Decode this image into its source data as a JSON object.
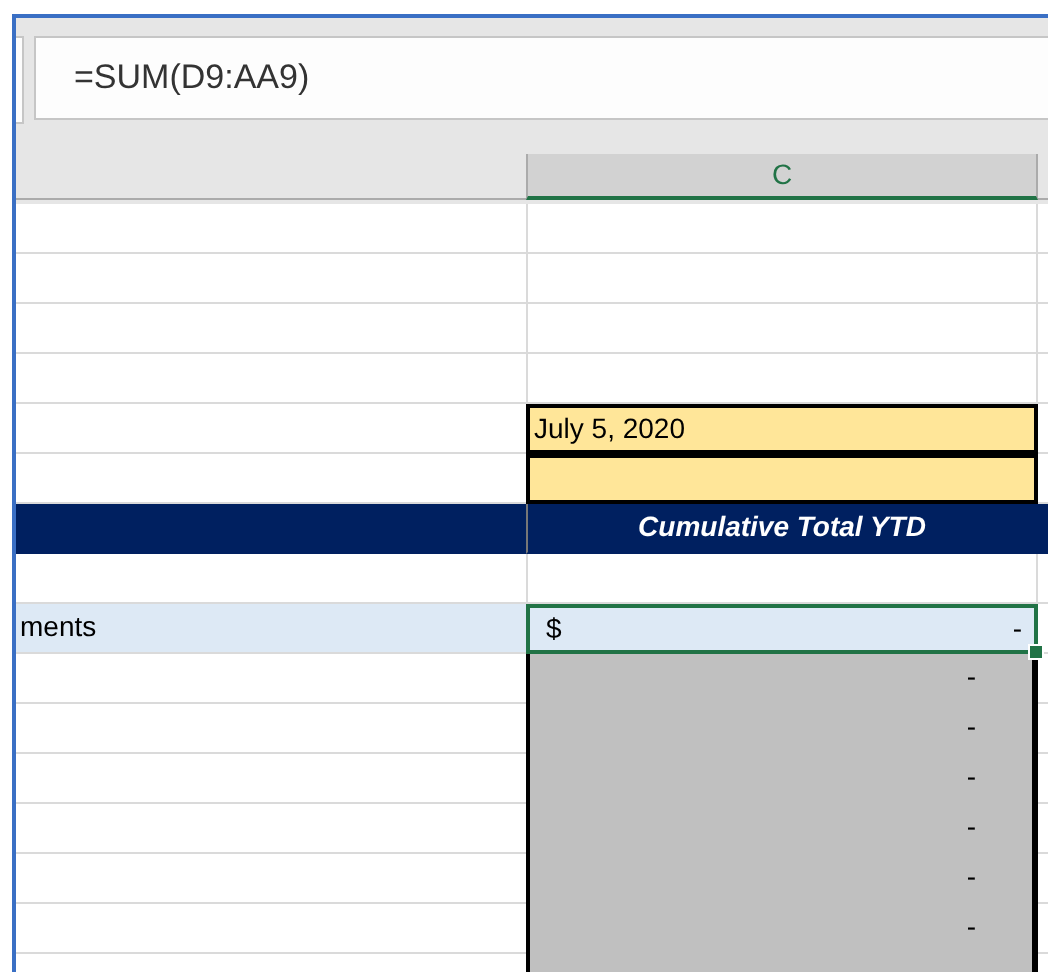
{
  "formula_bar": {
    "formula": "=SUM(D9:AA9)"
  },
  "column_header": {
    "label": "C",
    "selected": true
  },
  "rows": [
    {
      "kind": "blank"
    },
    {
      "kind": "blank"
    },
    {
      "kind": "blank"
    },
    {
      "kind": "blank"
    },
    {
      "kind": "date",
      "value": "July 5, 2020"
    },
    {
      "kind": "date"
    },
    {
      "kind": "banner",
      "value": "Cumulative Total YTD"
    },
    {
      "kind": "blank"
    },
    {
      "kind": "value",
      "label": "ments",
      "currency": "$",
      "value": "-",
      "selected": true
    },
    {
      "kind": "gray",
      "value": "-"
    },
    {
      "kind": "gray",
      "value": "-"
    },
    {
      "kind": "gray",
      "value": "-"
    },
    {
      "kind": "gray",
      "value": "-"
    },
    {
      "kind": "gray",
      "value": "-"
    },
    {
      "kind": "gray",
      "value": "-"
    },
    {
      "kind": "gray"
    }
  ]
}
